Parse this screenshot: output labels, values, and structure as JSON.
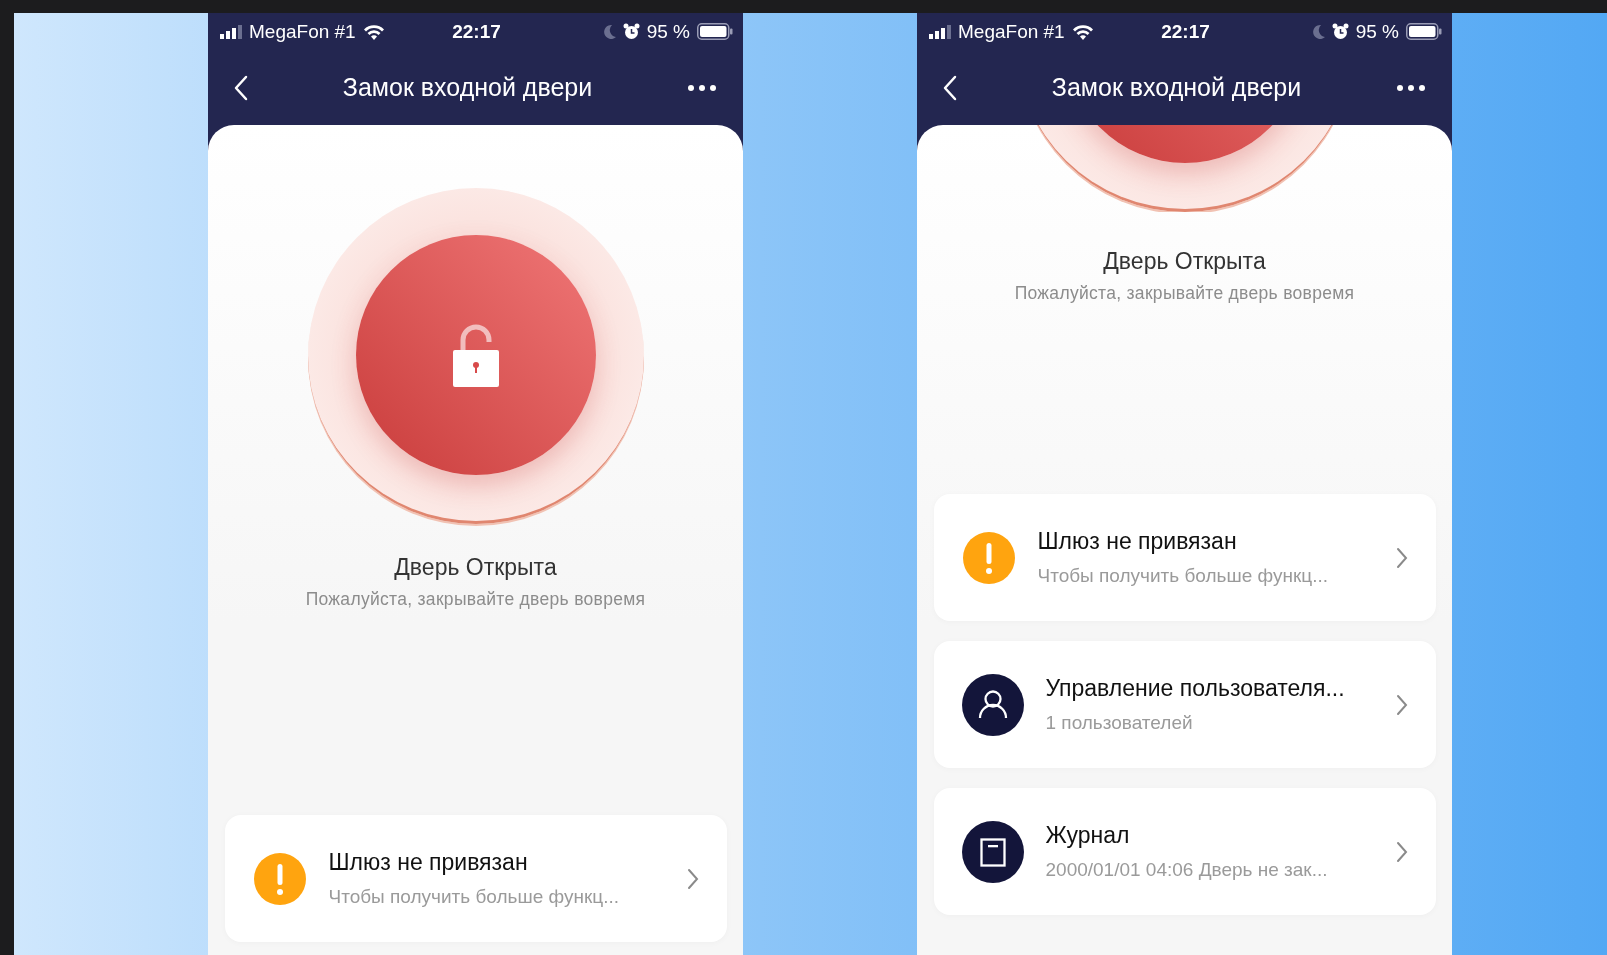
{
  "phones": [
    {
      "status_bar": {
        "carrier": "MegaFon #1",
        "time": "22:17",
        "battery": "95 %"
      },
      "header": {
        "title": "Замок входной двери"
      },
      "lock": {
        "cropped": false,
        "locked": false
      },
      "status": {
        "title": "Дверь Открыта",
        "subtitle": "Пожалуйста, закрывайте дверь вовремя"
      },
      "items": [
        {
          "kind": "warning",
          "title": "Шлюз не привязан",
          "subtitle": "Чтобы получить больше функц..."
        }
      ]
    },
    {
      "status_bar": {
        "carrier": "MegaFon #1",
        "time": "22:17",
        "battery": "95 %"
      },
      "header": {
        "title": "Замок входной двери"
      },
      "lock": {
        "cropped": true
      },
      "status": {
        "title": "Дверь Открыта",
        "subtitle": "Пожалуйста, закрывайте дверь вовремя"
      },
      "items": [
        {
          "kind": "warning",
          "title": "Шлюз не привязан",
          "subtitle": "Чтобы получить больше функц..."
        },
        {
          "kind": "users",
          "title": "Управление пользователя...",
          "subtitle": "1 пользователей"
        },
        {
          "kind": "log",
          "title": "Журнал",
          "subtitle": "2000/01/01 04:06 Дверь не зак..."
        }
      ]
    }
  ]
}
